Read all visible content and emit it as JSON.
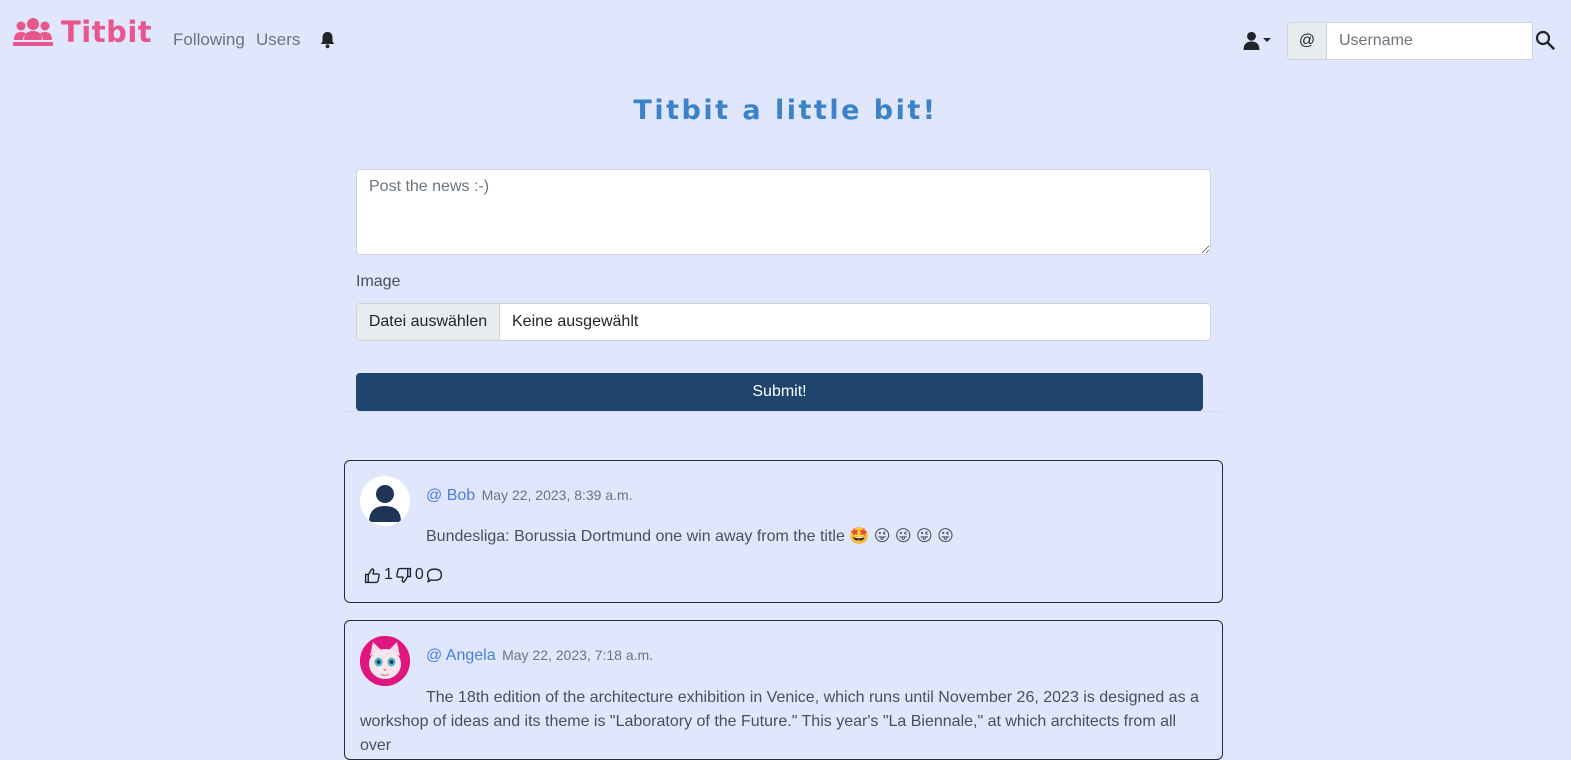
{
  "app": {
    "name": "Titbit"
  },
  "nav": {
    "following": "Following",
    "users": "Users",
    "search_prefix": "@",
    "search_placeholder": "Username"
  },
  "page": {
    "title": "Titbit a little bit!"
  },
  "form": {
    "textarea_placeholder": "Post the news :-)",
    "image_label": "Image",
    "file_button": "Datei auswählen",
    "file_status": "Keine ausgewählt",
    "submit_label": "Submit!"
  },
  "posts": [
    {
      "user": "@ Bob",
      "date": "May 22, 2023, 8:39 a.m.",
      "text": "Bundesliga: Borussia Dortmund one win away from the title 🤩 😜 😜 😜 😜",
      "likes": "1",
      "dislikes": "0"
    },
    {
      "user": "@ Angela",
      "date": "May 22, 2023, 7:18 a.m.",
      "text": "The 18th edition of the architecture exhibition in Venice, which runs until November 26, 2023 is designed as a workshop of ideas and its theme is \"Laboratory of the Future.\" This year's \"La Biennale,\" at which architects from all over"
    }
  ],
  "colors": {
    "background": "#e0e6fb",
    "brand": "#e8578b",
    "title": "#3c82c8",
    "submit": "#1e446e",
    "link": "#4a7fd6"
  },
  "icons": [
    "users-icon",
    "bell-icon",
    "user-icon",
    "caret-down-icon",
    "search-icon",
    "thumbs-up-icon",
    "thumbs-down-icon",
    "comment-icon"
  ]
}
